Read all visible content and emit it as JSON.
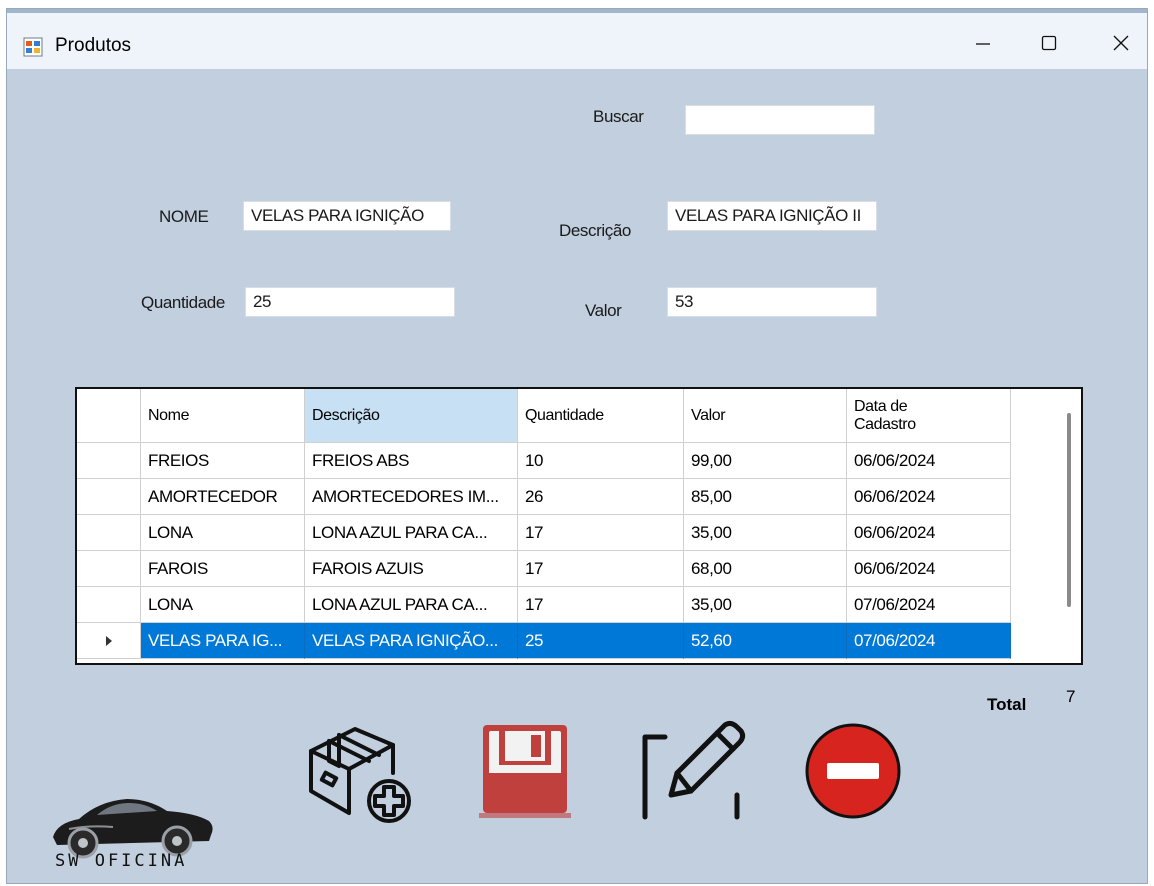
{
  "window": {
    "title": "Produtos",
    "controls": {
      "minimize": "minimize-icon",
      "maximize": "maximize-icon",
      "close": "close-icon"
    }
  },
  "form": {
    "search_label": "Buscar",
    "search_value": "",
    "name_label": "NOME",
    "name_value": "VELAS PARA IGNIÇÃO",
    "description_label": "Descrição",
    "description_value": "VELAS PARA IGNIÇÃO II",
    "quantity_label": "Quantidade",
    "quantity_value": "25",
    "value_label": "Valor",
    "value_value": "53"
  },
  "table": {
    "columns": [
      "Nome",
      "Descrição",
      "Quantidade",
      "Valor",
      "Data de Cadastro"
    ],
    "rows": [
      [
        "FREIOS",
        "FREIOS ABS",
        "10",
        "99,00",
        "06/06/2024"
      ],
      [
        "AMORTECEDOR",
        "AMORTECEDORES IM...",
        "26",
        "85,00",
        "06/06/2024"
      ],
      [
        "LONA",
        "LONA AZUL PARA CA...",
        "17",
        "35,00",
        "06/06/2024"
      ],
      [
        "FAROIS",
        "FAROIS AZUIS",
        "17",
        "68,00",
        "06/06/2024"
      ],
      [
        "LONA",
        "LONA AZUL PARA CA...",
        "17",
        "35,00",
        "07/06/2024"
      ],
      [
        "VELAS PARA IG...",
        "VELAS PARA IGNIÇÃO...",
        "25",
        "52,60",
        "07/06/2024"
      ]
    ],
    "selected_row": 5,
    "selected_header": "Descrição",
    "row_indicator_icon": "row-pointer-icon"
  },
  "summary": {
    "total_label": "Total",
    "total_value": "7"
  },
  "actions": [
    {
      "name": "add-product-button",
      "icon": "box-plus-icon"
    },
    {
      "name": "save-button",
      "icon": "floppy-disk-icon"
    },
    {
      "name": "edit-button",
      "icon": "pencil-edit-icon"
    },
    {
      "name": "delete-button",
      "icon": "minus-circle-icon"
    }
  ],
  "branding": {
    "logo_text": "SW OFICINA",
    "logo_icon": "sports-car-icon"
  },
  "colors": {
    "window_bg": "#c1cfde",
    "selection": "#0078d7",
    "header_selected": "#c7e0f4",
    "save_red": "#c0403d",
    "delete_red": "#d8241f"
  }
}
